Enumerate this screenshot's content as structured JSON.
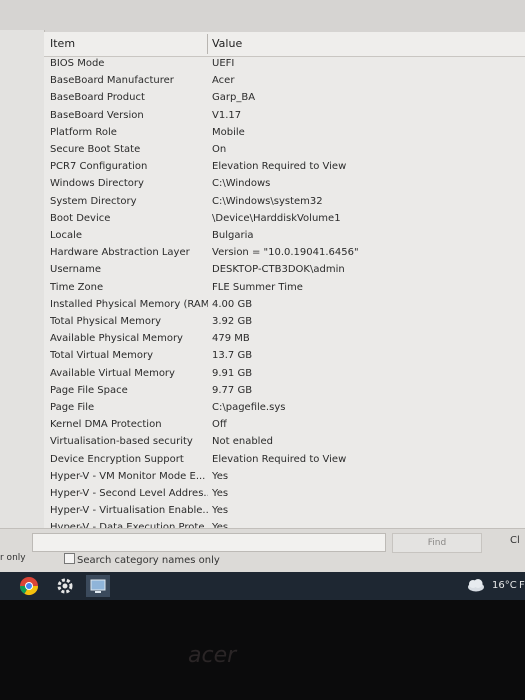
{
  "table": {
    "header_item": "Item",
    "header_value": "Value",
    "rows": [
      {
        "item": "BIOS Mode",
        "value": "UEFI"
      },
      {
        "item": "BaseBoard Manufacturer",
        "value": "Acer"
      },
      {
        "item": "BaseBoard Product",
        "value": "Garp_BA"
      },
      {
        "item": "BaseBoard Version",
        "value": "V1.17"
      },
      {
        "item": "Platform Role",
        "value": "Mobile"
      },
      {
        "item": "Secure Boot State",
        "value": "On"
      },
      {
        "item": "PCR7 Configuration",
        "value": "Elevation Required to View"
      },
      {
        "item": "Windows Directory",
        "value": "C:\\Windows"
      },
      {
        "item": "System Directory",
        "value": "C:\\Windows\\system32"
      },
      {
        "item": "Boot Device",
        "value": "\\Device\\HarddiskVolume1"
      },
      {
        "item": "Locale",
        "value": "Bulgaria"
      },
      {
        "item": "Hardware Abstraction Layer",
        "value": "Version = \"10.0.19041.6456\""
      },
      {
        "item": "Username",
        "value": "DESKTOP-CTB3DOK\\admin"
      },
      {
        "item": "Time Zone",
        "value": "FLE Summer Time"
      },
      {
        "item": "Installed Physical Memory (RAM)",
        "value": "4.00 GB"
      },
      {
        "item": "Total Physical Memory",
        "value": "3.92 GB"
      },
      {
        "item": "Available Physical Memory",
        "value": "479 MB"
      },
      {
        "item": "Total Virtual Memory",
        "value": "13.7 GB"
      },
      {
        "item": "Available Virtual Memory",
        "value": "9.91 GB"
      },
      {
        "item": "Page File Space",
        "value": "9.77 GB"
      },
      {
        "item": "Page File",
        "value": "C:\\pagefile.sys"
      },
      {
        "item": "Kernel DMA Protection",
        "value": "Off"
      },
      {
        "item": "Virtualisation-based security",
        "value": "Not enabled"
      },
      {
        "item": "Device Encryption Support",
        "value": "Elevation Required to View"
      },
      {
        "item": "Hyper-V - VM Monitor Mode E...",
        "value": "Yes"
      },
      {
        "item": "Hyper-V - Second Level Addres...",
        "value": "Yes"
      },
      {
        "item": "Hyper-V - Virtualisation Enable...",
        "value": "Yes"
      },
      {
        "item": "Hyper-V - Data Execution Prote...",
        "value": "Yes"
      }
    ]
  },
  "find": {
    "button_label": "Find",
    "close_label": "Cl",
    "only_label": "r only",
    "search_category_label": "Search category names only"
  },
  "taskbar": {
    "weather": "16°C",
    "edge_char": "F"
  },
  "colors": {
    "taskbar": "#1e2732",
    "window": "#ebeae8"
  },
  "icons": [
    "chrome-icon",
    "settings-icon",
    "system-information-icon",
    "weather-icon"
  ]
}
